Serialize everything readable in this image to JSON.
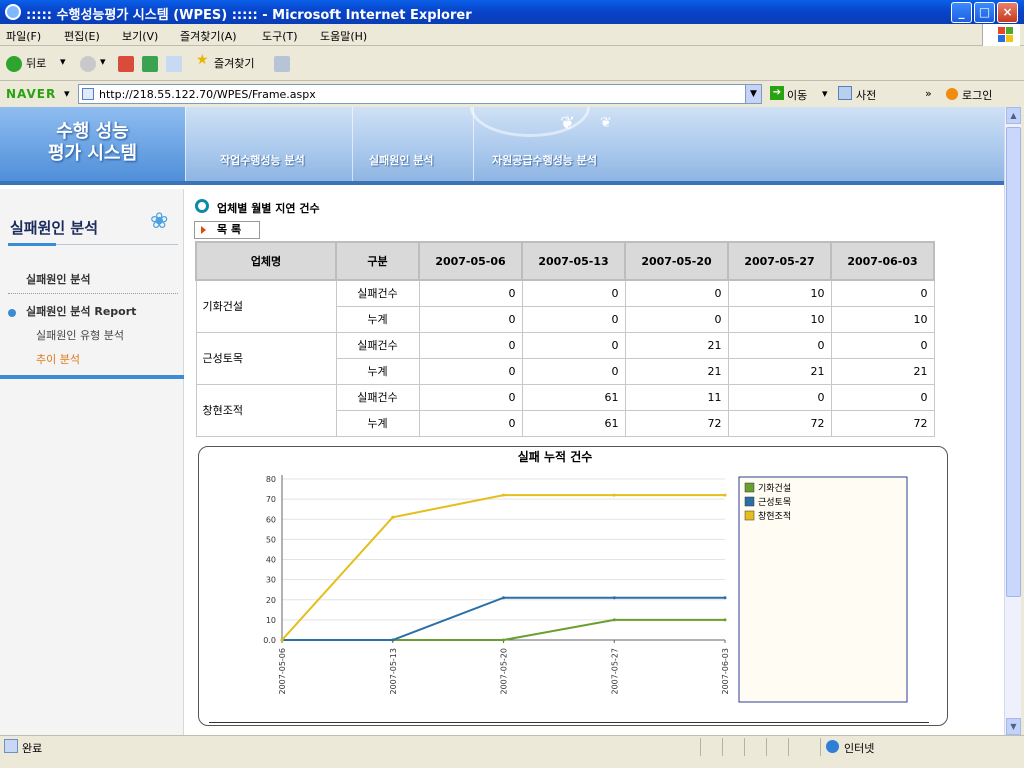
{
  "window": {
    "title": "::::: 수행성능평가 시스템 (WPES) ::::: - Microsoft Internet Explorer",
    "min": "_",
    "max": "□",
    "close": "×"
  },
  "menu": [
    "파일(F)",
    "편집(E)",
    "보기(V)",
    "즐겨찾기(A)",
    "도구(T)",
    "도움말(H)"
  ],
  "toolbar": {
    "back": "뒤로",
    "favorites": "즐겨찾기"
  },
  "address": {
    "naver": "NAVER",
    "url": "http://218.55.122.70/WPES/Frame.aspx",
    "go": "이동",
    "dict": "사전",
    "more": "»",
    "login": "로그인"
  },
  "header": {
    "logo_line1": "수행 성능",
    "logo_line2": "평가 시스템",
    "nav": [
      "작업수행성능 분석",
      "실패원인 분석",
      "자원공급수행성능 분석"
    ]
  },
  "sidebar": {
    "title": "실패원인 분석",
    "items": [
      "실패원인 분석",
      "실패원인 분석 Report",
      "실패원인 유형 분석",
      "추이 분석"
    ]
  },
  "content": {
    "title": "업체별 월별 지연 건수",
    "list_button": "목 록"
  },
  "table": {
    "headers": [
      "업체명",
      "구분",
      "2007-05-06",
      "2007-05-13",
      "2007-05-20",
      "2007-05-27",
      "2007-06-03"
    ],
    "groups": [
      {
        "name": "기화건설",
        "rows": [
          {
            "kind": "실패건수",
            "values": [
              "0",
              "0",
              "0",
              "10",
              "0"
            ]
          },
          {
            "kind": "누계",
            "values": [
              "0",
              "0",
              "0",
              "10",
              "10"
            ]
          }
        ]
      },
      {
        "name": "근성토목",
        "rows": [
          {
            "kind": "실패건수",
            "values": [
              "0",
              "0",
              "21",
              "0",
              "0"
            ]
          },
          {
            "kind": "누계",
            "values": [
              "0",
              "0",
              "21",
              "21",
              "21"
            ]
          }
        ]
      },
      {
        "name": "창현조적",
        "rows": [
          {
            "kind": "실패건수",
            "values": [
              "0",
              "61",
              "11",
              "0",
              "0"
            ]
          },
          {
            "kind": "누계",
            "values": [
              "0",
              "61",
              "72",
              "72",
              "72"
            ]
          }
        ]
      }
    ]
  },
  "chart_data": {
    "type": "line",
    "title": "실패 누적 건수",
    "xlabel": "",
    "ylabel": "",
    "x": [
      "2007-05-06",
      "2007-05-13",
      "2007-05-20",
      "2007-05-27",
      "2007-06-03"
    ],
    "ylim": [
      0,
      80
    ],
    "yticks": [
      "0.0",
      "10",
      "20",
      "30",
      "40",
      "50",
      "60",
      "70",
      "80"
    ],
    "grid": true,
    "legend": "right",
    "series": [
      {
        "name": "기화건설",
        "color": "#6a9e2e",
        "values": [
          0,
          0,
          0,
          10,
          10
        ]
      },
      {
        "name": "근성토목",
        "color": "#2b6fa8",
        "values": [
          0,
          0,
          21,
          21,
          21
        ]
      },
      {
        "name": "창현조적",
        "color": "#e4be1c",
        "values": [
          0,
          61,
          72,
          72,
          72
        ]
      }
    ]
  },
  "status": {
    "done": "완료",
    "zone": "인터넷"
  }
}
